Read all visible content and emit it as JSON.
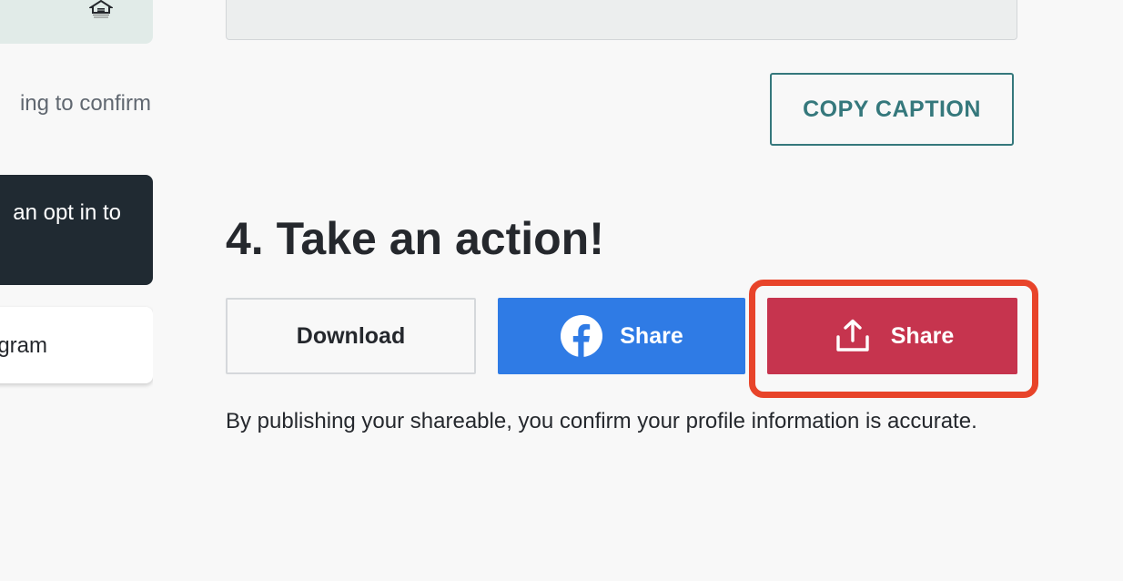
{
  "left": {
    "partial_text": "ing to confirm",
    "dark_card_text": "an opt in to",
    "white_card_text": "gram",
    "logo_icon": "equal-housing-opportunity-icon"
  },
  "caption": {
    "copy_button_label": "COPY CAPTION"
  },
  "action_section": {
    "title": "4. Take an action!",
    "download_label": "Download",
    "facebook_share_label": "Share",
    "facebook_icon": "facebook-icon",
    "share_label": "Share",
    "share_icon": "share-upload-icon",
    "disclaimer": "By publishing your shareable, you confirm your profile information is accurate."
  },
  "colors": {
    "teal_accent": "#35787c",
    "facebook_blue": "#2f7be5",
    "share_red": "#c6344e",
    "highlight_orange": "#e8442a",
    "dark_card": "#202a32"
  }
}
